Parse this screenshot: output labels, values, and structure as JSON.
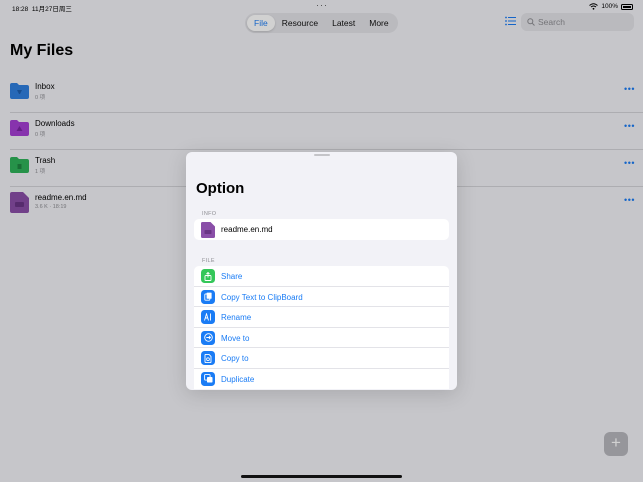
{
  "status": {
    "time": "18:28",
    "date": "11月27日周三",
    "battery": "100%"
  },
  "tabs": [
    {
      "label": "File",
      "active": true
    },
    {
      "label": "Resource",
      "active": false
    },
    {
      "label": "Latest",
      "active": false
    },
    {
      "label": "More",
      "active": false
    }
  ],
  "search": {
    "placeholder": "Search"
  },
  "page": {
    "title": "My Files"
  },
  "files": [
    {
      "name": "Inbox",
      "meta": "0 项",
      "icon": "folder-inbox-icon",
      "color": "#2f7fe0"
    },
    {
      "name": "Downloads",
      "meta": "0 项",
      "icon": "folder-downloads-icon",
      "color": "#a53fd3"
    },
    {
      "name": "Trash",
      "meta": "1 项",
      "icon": "folder-trash-icon",
      "color": "#2fb35a"
    },
    {
      "name": "readme.en.md",
      "meta": "3.6 K · 18:19",
      "icon": "markdown-file-icon",
      "color": "#8a4fa8"
    }
  ],
  "more_glyph": "•••",
  "sheet": {
    "title": "Option",
    "info_label": "INFO",
    "file_name": "readme.en.md",
    "file_label": "FILE",
    "actions": [
      {
        "label": "Share",
        "icon": "share-icon",
        "color": "#34c759"
      },
      {
        "label": "Copy Text to ClipBoard",
        "icon": "copy-clipboard-icon",
        "color": "#1a7cf5"
      },
      {
        "label": "Rename",
        "icon": "rename-icon",
        "color": "#1a7cf5"
      },
      {
        "label": "Move to",
        "icon": "move-to-icon",
        "color": "#1a7cf5"
      },
      {
        "label": "Copy to",
        "icon": "copy-to-icon",
        "color": "#1a7cf5"
      },
      {
        "label": "Duplicate",
        "icon": "duplicate-icon",
        "color": "#1a7cf5"
      }
    ]
  },
  "colors": {
    "accent": "#1a7cf5"
  }
}
